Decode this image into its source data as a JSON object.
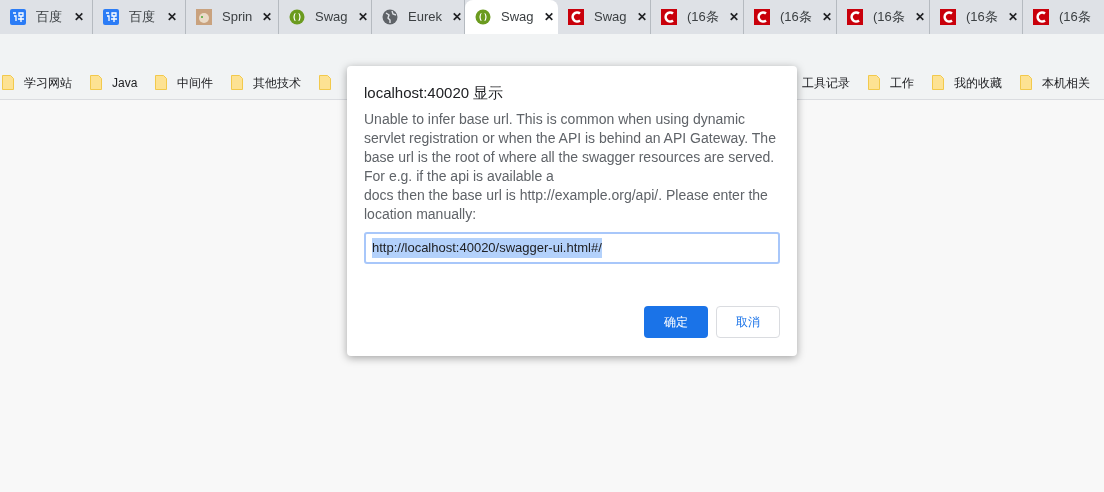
{
  "tabs": [
    {
      "title": "百度",
      "kind": "translate",
      "selected": false
    },
    {
      "title": "百度",
      "kind": "translate",
      "selected": false
    },
    {
      "title": "Sprin",
      "kind": "photo",
      "selected": false
    },
    {
      "title": "Swag",
      "kind": "swagger",
      "selected": false
    },
    {
      "title": "Eurek",
      "kind": "globe",
      "selected": false
    },
    {
      "title": "Swag",
      "kind": "swagger",
      "selected": true
    },
    {
      "title": "Swag",
      "kind": "csdn",
      "selected": false
    },
    {
      "title": "(16条",
      "kind": "csdn",
      "selected": false
    },
    {
      "title": "(16条",
      "kind": "csdn",
      "selected": false
    },
    {
      "title": "(16条",
      "kind": "csdn",
      "selected": false
    },
    {
      "title": "(16条",
      "kind": "csdn",
      "selected": false
    },
    {
      "title": "(16条",
      "kind": "csdn",
      "selected": false
    }
  ],
  "tab_close": "✕",
  "bookmarks_left": [
    "学习网站",
    "Java",
    "中间件",
    "其他技术"
  ],
  "bookmarks_right": [
    "工具记录",
    "工作",
    "我的收藏",
    "本机相关"
  ],
  "dialog": {
    "title": "localhost:40020 显示",
    "message_start": "Unable to infer base url. This is common when using dynamic servlet registration or when the API is behind an API Gateway. The base url is the root of where all the swagger resources are served. For e.g. if the api is available a",
    "message_end": "docs then the base url is http://example.org/api/. Please enter the location manually:",
    "value": "http://localhost:40020/swagger-ui.html#/",
    "value_selected": true,
    "buttons": [
      {
        "label": "确定",
        "kind": "primary"
      },
      {
        "label": "取消",
        "kind": "secondary"
      }
    ]
  }
}
